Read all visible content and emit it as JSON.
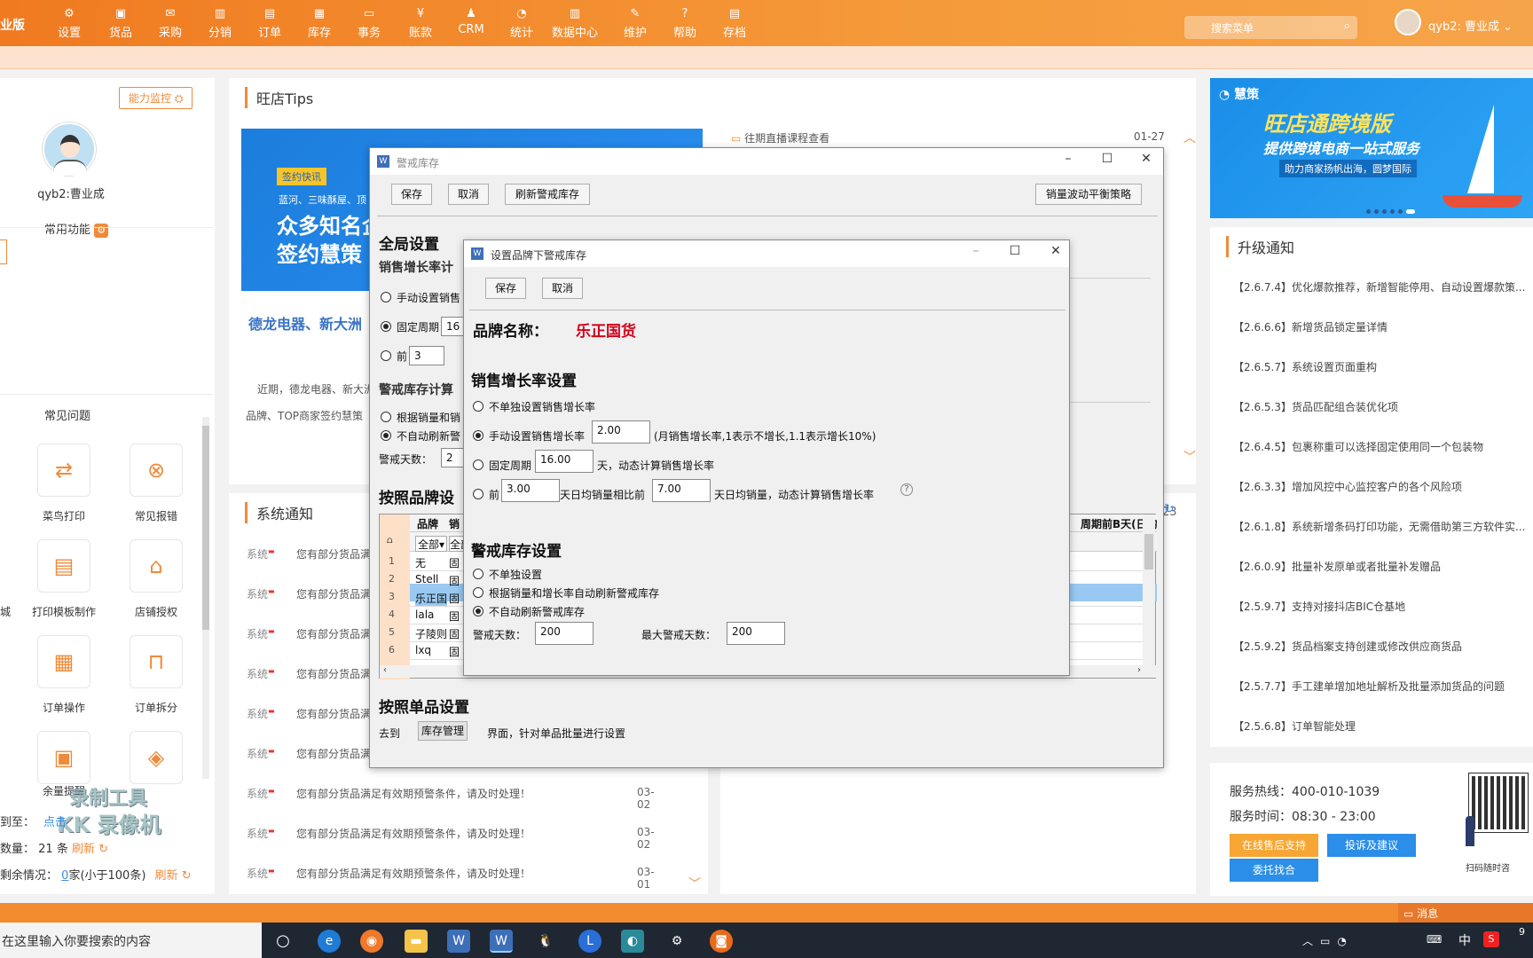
{
  "topbar": {
    "edition": "业版",
    "nav": [
      "设置",
      "货品",
      "采购",
      "分销",
      "订单",
      "库存",
      "事务",
      "账款",
      "CRM",
      "统计",
      "数据中心",
      "维护",
      "帮助",
      "存档"
    ],
    "search_placeholder": "搜索菜单",
    "user": "qyb2: 曹业成"
  },
  "left": {
    "monitor_btn": "能力监控",
    "username": "qyb2:曹业成",
    "common_functions": "常用功能",
    "faq_title": "常见问题",
    "quick": [
      "菜鸟打印",
      "常见报错",
      "打印模板制作",
      "店铺授权",
      "订单操作",
      "订单拆分",
      "余量提醒",
      ""
    ],
    "edge_label": "城",
    "expire_label": "到至：",
    "expire_link": "点击",
    "count_label": "数量：",
    "count_value": "21 条",
    "refresh": "刷新",
    "balance_label": "剩余情况：",
    "balance_value": "0",
    "balance_unit": "家(小于100条)",
    "watermark1": "录制工具",
    "watermark2": "KK 录像机"
  },
  "tips": {
    "title": "旺店Tips",
    "banner_tag": "签约快讯",
    "banner_small": "蓝河、三味酥屋、顶",
    "banner_big1": "众多知名企",
    "banner_big2": "签约慧策",
    "headline": "德龙电器、新大洲",
    "desc1": "近期，德龙电器、新大洲",
    "desc2": "品牌、TOP商家签约慧策",
    "live_link": "往期直播课程查看",
    "live_date": "01-27"
  },
  "system_notice": {
    "title": "系统通知",
    "rows": [
      {
        "tag": "系统",
        "text": "您有部分货品满",
        "date": ""
      },
      {
        "tag": "系统",
        "text": "您有部分货品满",
        "date": ""
      },
      {
        "tag": "系统",
        "text": "您有部分货品满",
        "date": ""
      },
      {
        "tag": "系统",
        "text": "您有部分货品满",
        "date": ""
      },
      {
        "tag": "系统",
        "text": "您有部分货品满",
        "date": ""
      },
      {
        "tag": "系统",
        "text": "您有部分货品满",
        "date": ""
      },
      {
        "tag": "系统",
        "text": "您有部分货品满足有效期预警条件，请及时处理！",
        "date": "03-02"
      },
      {
        "tag": "系统",
        "text": "您有部分货品满足有效期预警条件，请及时处理！",
        "date": "03-02"
      },
      {
        "tag": "系统",
        "text": "您有部分货品满足有效期预警条件，请及时处理！",
        "date": "03-01"
      }
    ],
    "side_date": "23"
  },
  "right": {
    "ad_brand": "慧策",
    "ad_title": "旺店通跨境版",
    "ad_sub": "提供跨境电商一站式服务",
    "ad_tag": "助力商家扬帆出海，圆梦国际",
    "upgrade_title": "升级通知",
    "updates": [
      "【2.6.7.4】优化爆款推荐，新增智能停用、自动设置爆款策...",
      "【2.6.6.6】新增货品锁定量详情",
      "【2.6.5.7】系统设置页面重构",
      "【2.6.5.3】货品匹配组合装优化项",
      "【2.6.4.5】包裹称重可以选择固定使用同一个包装物",
      "【2.6.3.3】增加风控中心监控客户的各个风险项",
      "【2.6.1.8】系统新增条码打印功能，无需借助第三方软件实...",
      "【2.6.0.9】批量补发原单或者批量补发赠品",
      "【2.5.9.7】支持对接抖店BIC仓基地",
      "【2.5.9.2】货品档案支持创建或修改供应商货品",
      "【2.5.7.7】手工建单增加地址解析及批量添加货品的问题",
      "【2.5.6.8】订单智能处理"
    ],
    "hotline": "服务热线：400-010-1039",
    "hours": "服务时间：08:30 - 23:00",
    "btn_online": "在线售后支持",
    "btn_complain": "投诉及建议",
    "btn_entrust": "委托找合",
    "qr_caption": "扫码随时咨"
  },
  "win_alert": {
    "title": "警戒库存",
    "save": "保存",
    "cancel": "取消",
    "refresh": "刷新警戒库存",
    "strategy": "销量波动平衡策略",
    "global": "全局设置",
    "growth": "销售增长率计",
    "opt_manual": "手动设置销售",
    "opt_fixed": "固定周期",
    "fixed_val": "16",
    "opt_prev": "前",
    "prev_val": "3",
    "alert_calc": "警戒库存计算",
    "opt_by_sales": "根据销量和销",
    "opt_no_auto": "不自动刷新警",
    "alert_days_label": "警戒天数：",
    "alert_days_val": "2",
    "by_brand": "按照品牌设",
    "grid_headers": [
      "品牌",
      "销"
    ],
    "grid_filter": [
      "全部",
      "全部"
    ],
    "grid_rows": [
      {
        "n": "1",
        "brand": "无",
        "v": "固"
      },
      {
        "n": "2",
        "brand": "Stell",
        "v": "固"
      },
      {
        "n": "3",
        "brand": "乐正国",
        "v": "固"
      },
      {
        "n": "4",
        "brand": "lala",
        "v": "固"
      },
      {
        "n": "5",
        "brand": "子陵则",
        "v": "固"
      },
      {
        "n": "6",
        "brand": "lxq",
        "v": "固"
      }
    ],
    "grid_right_header": "周期前B天(日均",
    "by_single": "按照单品设置",
    "goto": "去到",
    "stock_mgmt": "库存管理",
    "goto_tail": "界面，针对单品批量进行设置"
  },
  "win_brand": {
    "title": "设置品牌下警戒库存",
    "save": "保存",
    "cancel": "取消",
    "brand_label": "品牌名称：",
    "brand_value": "乐正国货",
    "growth_title": "销售增长率设置",
    "opt1": "不单独设置销售增长率",
    "opt2": "手动设置销售增长率",
    "opt2_val": "2.00",
    "opt2_hint": "(月销售增长率,1表示不增长,1.1表示增长10%)",
    "opt3": "固定周期",
    "opt3_val": "16.00",
    "opt3_tail": "天，动态计算销售增长率",
    "opt4": "前",
    "opt4_val": "3.00",
    "opt4_mid": "天日均销量相比前",
    "opt4_val2": "7.00",
    "opt4_tail": "天日均销量，动态计算销售增长率",
    "alert_title": "警戒库存设置",
    "a1": "不单独设置",
    "a2": "根据销量和增长率自动刷新警戒库存",
    "a3": "不自动刷新警戒库存",
    "days_label": "警戒天数：",
    "days_val": "200",
    "max_label": "最大警戒天数：",
    "max_val": "200"
  },
  "bottom": {
    "msg": "消息",
    "taskbar_search": "在这里输入你要搜索的内容",
    "ime": "中",
    "clock": "9"
  },
  "colors": {
    "accent": "#f08a3a",
    "brand_red": "#d0021b",
    "select": "#99c9f2"
  }
}
